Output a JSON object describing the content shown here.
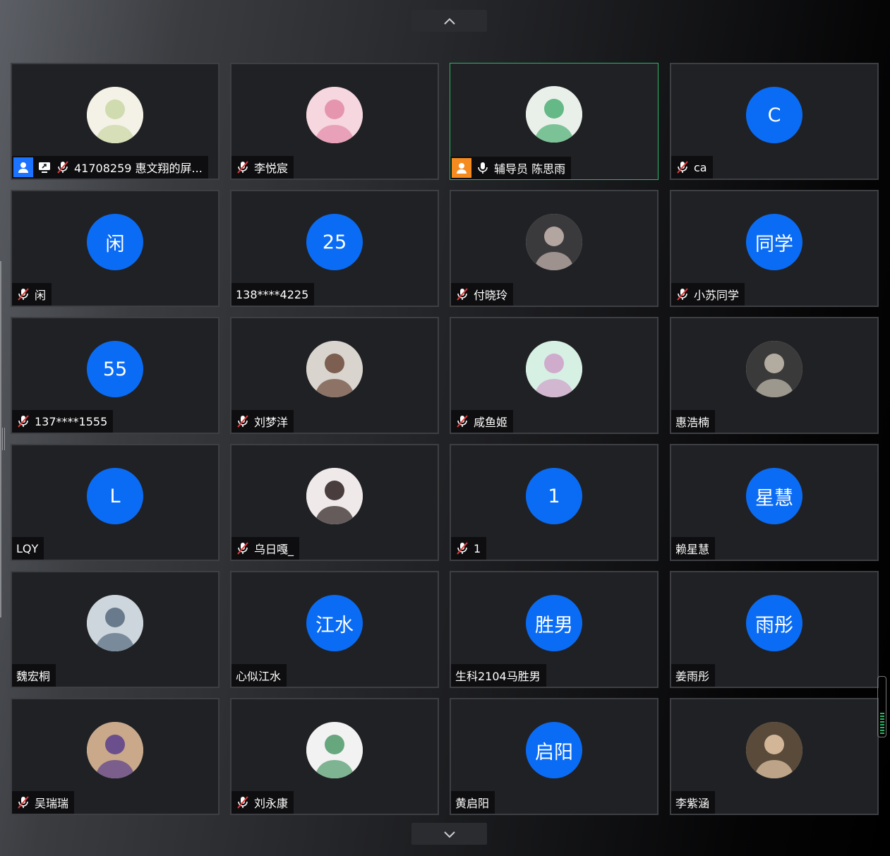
{
  "nav": {
    "up_icon": "chevron-up-icon",
    "down_icon": "chevron-down-icon"
  },
  "colors": {
    "avatar_blue": "#0a6cf5",
    "active_border": "#2fb36a",
    "share_badge": "#1b73ff",
    "host_badge": "#f58a1f"
  },
  "participants": [
    {
      "name": "41708259  惠文翔的屏...",
      "avatar_text": "",
      "avatar_type": "photo",
      "muted": true,
      "sharing": true,
      "host": false,
      "active": false
    },
    {
      "name": "李悦宸",
      "avatar_text": "",
      "avatar_type": "photo",
      "muted": true,
      "sharing": false,
      "host": false,
      "active": false
    },
    {
      "name": "辅导员 陈思雨",
      "avatar_text": "",
      "avatar_type": "photo",
      "muted": false,
      "sharing": false,
      "host": true,
      "active": true
    },
    {
      "name": "ca",
      "avatar_text": "C",
      "avatar_type": "initial",
      "muted": true,
      "sharing": false,
      "host": false,
      "active": false
    },
    {
      "name": "闲",
      "avatar_text": "闲",
      "avatar_type": "initial",
      "muted": true,
      "sharing": false,
      "host": false,
      "active": false
    },
    {
      "name": "138****4225",
      "avatar_text": "25",
      "avatar_type": "initial",
      "muted": false,
      "sharing": false,
      "host": false,
      "active": false
    },
    {
      "name": "付晓玲",
      "avatar_text": "",
      "avatar_type": "photo",
      "muted": true,
      "sharing": false,
      "host": false,
      "active": false
    },
    {
      "name": "小苏同学",
      "avatar_text": "同学",
      "avatar_type": "initial",
      "muted": true,
      "sharing": false,
      "host": false,
      "active": false
    },
    {
      "name": "137****1555",
      "avatar_text": "55",
      "avatar_type": "initial",
      "muted": true,
      "sharing": false,
      "host": false,
      "active": false
    },
    {
      "name": "刘梦洋",
      "avatar_text": "",
      "avatar_type": "photo",
      "muted": true,
      "sharing": false,
      "host": false,
      "active": false
    },
    {
      "name": "咸鱼姬",
      "avatar_text": "",
      "avatar_type": "photo",
      "muted": true,
      "sharing": false,
      "host": false,
      "active": false
    },
    {
      "name": "惠浩楠",
      "avatar_text": "",
      "avatar_type": "photo",
      "muted": false,
      "sharing": false,
      "host": false,
      "active": false
    },
    {
      "name": "LQY",
      "avatar_text": "L",
      "avatar_type": "initial",
      "muted": false,
      "sharing": false,
      "host": false,
      "active": false
    },
    {
      "name": "乌日嘎_",
      "avatar_text": "",
      "avatar_type": "photo",
      "muted": true,
      "sharing": false,
      "host": false,
      "active": false
    },
    {
      "name": "1",
      "avatar_text": "1",
      "avatar_type": "initial",
      "muted": true,
      "sharing": false,
      "host": false,
      "active": false
    },
    {
      "name": "赖星慧",
      "avatar_text": "星慧",
      "avatar_type": "initial",
      "muted": false,
      "sharing": false,
      "host": false,
      "active": false
    },
    {
      "name": "魏宏桐",
      "avatar_text": "",
      "avatar_type": "photo",
      "muted": false,
      "sharing": false,
      "host": false,
      "active": false
    },
    {
      "name": "心似江水",
      "avatar_text": "江水",
      "avatar_type": "initial",
      "muted": false,
      "sharing": false,
      "host": false,
      "active": false
    },
    {
      "name": "生科2104马胜男",
      "avatar_text": "胜男",
      "avatar_type": "initial",
      "muted": false,
      "sharing": false,
      "host": false,
      "active": false
    },
    {
      "name": "姜雨彤",
      "avatar_text": "雨彤",
      "avatar_type": "initial",
      "muted": false,
      "sharing": false,
      "host": false,
      "active": false
    },
    {
      "name": "吴瑞瑞",
      "avatar_text": "",
      "avatar_type": "photo",
      "muted": true,
      "sharing": false,
      "host": false,
      "active": false
    },
    {
      "name": "刘永康",
      "avatar_text": "",
      "avatar_type": "photo",
      "muted": true,
      "sharing": false,
      "host": false,
      "active": false
    },
    {
      "name": "黄启阳",
      "avatar_text": "启阳",
      "avatar_type": "initial",
      "muted": false,
      "sharing": false,
      "host": false,
      "active": false
    },
    {
      "name": "李紫涵",
      "avatar_text": "",
      "avatar_type": "photo",
      "muted": false,
      "sharing": false,
      "host": false,
      "active": false
    }
  ]
}
